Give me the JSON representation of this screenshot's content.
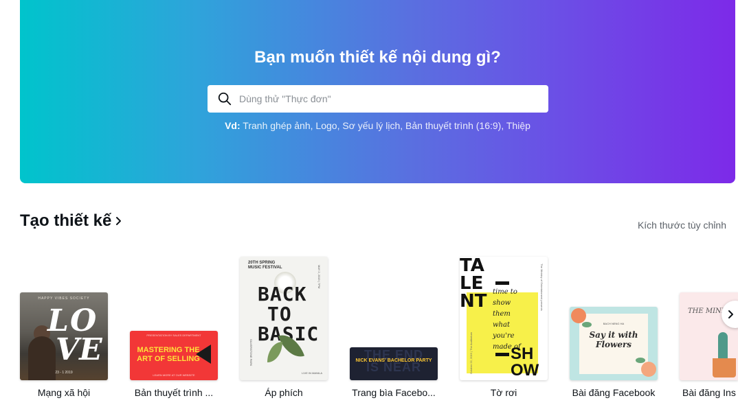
{
  "hero": {
    "title": "Bạn muốn thiết kế nội dung gì?",
    "search_placeholder": "Dùng thử \"Thực đơn\"",
    "suggestion_prefix": "Vd:",
    "suggestions": [
      "Tranh ghép ảnh",
      "Logo",
      "Sơ yếu lý lịch",
      "Bản thuyết trình (16:9)",
      "Thiệp"
    ],
    "gradient_colors": [
      "#00c4cc",
      "#7d2ae8"
    ]
  },
  "create_section": {
    "title": "Tạo thiết kế",
    "custom_size_link": "Kích thước tùy chỉnh"
  },
  "design_types": [
    {
      "label": "Mạng xã hội",
      "thumb_text": [
        "LO",
        "VE"
      ],
      "thumb_small": [
        "HAPPY VIBES SOCIETY",
        "23 - 1 2019"
      ]
    },
    {
      "label": "Bản thuyết trình ...",
      "thumb_text": "MASTERING THE ART OF SELLING",
      "thumb_small": [
        "PRESENTATION BY SALES DEPARTMENT",
        "LEARN MORE AT OUR WEBSITE"
      ]
    },
    {
      "label": "Áp phích",
      "thumb_text": [
        "BACK",
        "TO",
        "BASIC"
      ],
      "thumb_small": [
        "20TH SPRING MUSIC FESTIVAL",
        "SILVERSTONE PARK",
        "LIVE IN MANILA",
        "MAY 2, 2019 | 7PM"
      ]
    },
    {
      "label": "Trang bìa Facebo...",
      "thumb_text": "NICK EVANS' BACHELOR PARTY",
      "thumb_bg_text": [
        "THE END",
        "IS NEAR"
      ]
    },
    {
      "label": "Tờ rơi",
      "thumb_text": [
        "TA",
        "LE",
        "NT"
      ],
      "thumb_script": [
        "time to",
        "show",
        "them",
        "what",
        "you're",
        "made of"
      ],
      "thumb_show": [
        "SH",
        "OW"
      ],
      "thumb_small": [
        "The Ministry of Entertainment presents",
        "October 22, 2019 | The Auditorium"
      ]
    },
    {
      "label": "Bài đăng Facebook",
      "thumb_text": [
        "Say it with",
        "Flowers"
      ],
      "thumb_small": "BACH NENG HA"
    },
    {
      "label": "Bài đăng Ins",
      "thumb_text": "THE MINI"
    }
  ],
  "colors": {
    "accent": "#7d2ae8",
    "teal": "#00c4cc",
    "text": "#0e1318",
    "muted": "#5c6269"
  },
  "icons": {
    "search": "search-icon",
    "section_chevron": "chevron-right-icon",
    "carousel_next": "chevron-right-icon"
  }
}
